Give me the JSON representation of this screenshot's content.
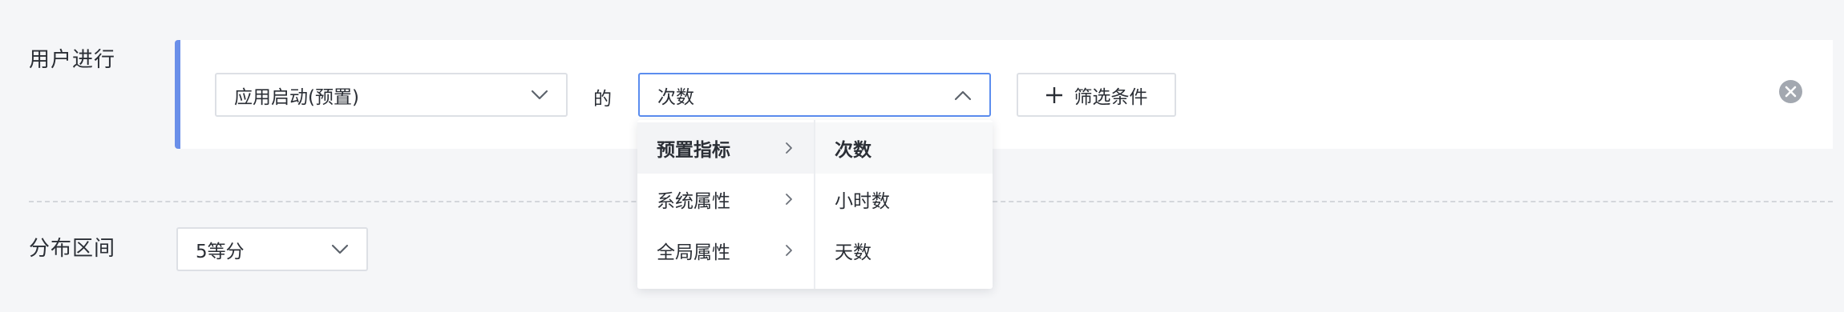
{
  "rows": {
    "user_label": "用户进行",
    "distribution_label": "分布区间"
  },
  "event": {
    "selected": "应用启动(预置)",
    "of_label": "的"
  },
  "metric": {
    "selected": "次数",
    "open": true
  },
  "filter": {
    "label": "筛选条件"
  },
  "distribution": {
    "selected": "5等分"
  },
  "dropdown": {
    "categories": [
      {
        "label": "预置指标",
        "active": true
      },
      {
        "label": "系统属性",
        "active": false
      },
      {
        "label": "全局属性",
        "active": false
      }
    ],
    "options": [
      {
        "label": "次数",
        "selected": true
      },
      {
        "label": "小时数",
        "selected": false
      },
      {
        "label": "天数",
        "selected": false
      }
    ]
  },
  "colors": {
    "accent": "#5b8def",
    "card_border": "#6a8fe9",
    "remove_icon": "#a3a8b0"
  },
  "icons": [
    "chevron-down-icon",
    "chevron-up-icon",
    "plus-icon",
    "close-circle-icon",
    "chevron-right-icon"
  ]
}
